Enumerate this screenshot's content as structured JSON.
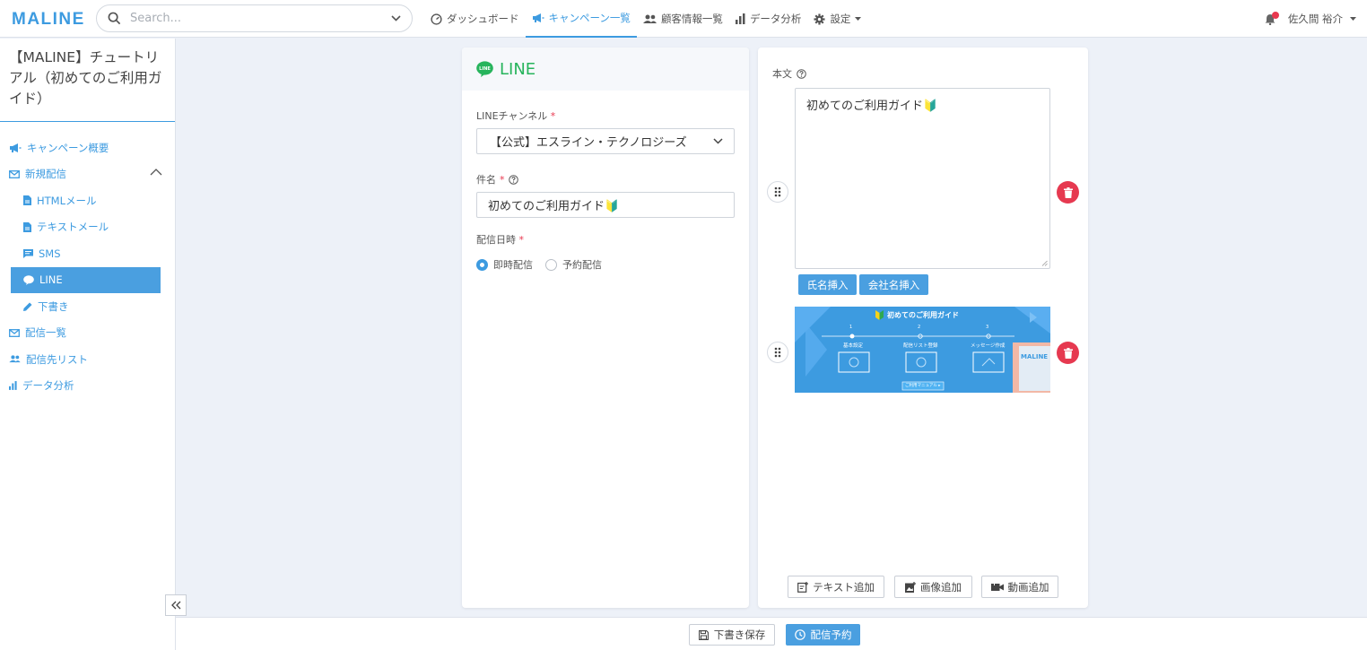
{
  "header": {
    "logo": "MALINE",
    "search_placeholder": "Search...",
    "nav": [
      {
        "label": "ダッシュボード",
        "icon": "gauge-icon"
      },
      {
        "label": "キャンペーン一覧",
        "icon": "megaphone-icon",
        "active": true
      },
      {
        "label": "顧客情報一覧",
        "icon": "people-icon"
      },
      {
        "label": "データ分析",
        "icon": "bar-chart-icon"
      },
      {
        "label": "設定",
        "icon": "gear-icon"
      }
    ],
    "user_name": "佐久間 裕介"
  },
  "sidebar": {
    "campaign_title": "【MALINE】チュートリアル（初めてのご利用ガイド）",
    "items": [
      {
        "label": "キャンペーン概要"
      },
      {
        "label": "新規配信"
      },
      {
        "label": "HTMLメール"
      },
      {
        "label": "テキストメール"
      },
      {
        "label": "SMS"
      },
      {
        "label": "LINE"
      },
      {
        "label": "下書き"
      },
      {
        "label": "配信一覧"
      },
      {
        "label": "配信先リスト"
      },
      {
        "label": "データ分析"
      }
    ]
  },
  "left_card": {
    "title": "LINE",
    "channel_label": "LINEチャンネル",
    "channel_value": "【公式】エスライン・テクノロジーズ",
    "subject_label": "件名",
    "subject_value": "初めてのご利用ガイド🔰",
    "date_label": "配信日時",
    "radio_immediate": "即時配信",
    "radio_scheduled": "予約配信",
    "required_mark": "*"
  },
  "right_card": {
    "body_label": "本文",
    "message_text": "初めてのご利用ガイド🔰",
    "insert_name": "氏名挿入",
    "insert_company": "会社名挿入",
    "banner": {
      "title": "初めてのご利用ガイド",
      "step1_num": "1",
      "step2_num": "2",
      "step3_num": "3",
      "step1": "基本設定",
      "step2": "配信リスト登録",
      "step3": "メッセージ作成",
      "button": "ご利用マニュアル ▸",
      "brand": "MALINE"
    },
    "add_text": "テキスト追加",
    "add_image": "画像追加",
    "add_video": "動画追加"
  },
  "footer": {
    "save_draft": "下書き保存",
    "schedule": "配信予約"
  },
  "colors": {
    "accent": "#3d9be0",
    "line_green": "#27b45c",
    "danger": "#e63950",
    "background": "#edf1f8"
  }
}
